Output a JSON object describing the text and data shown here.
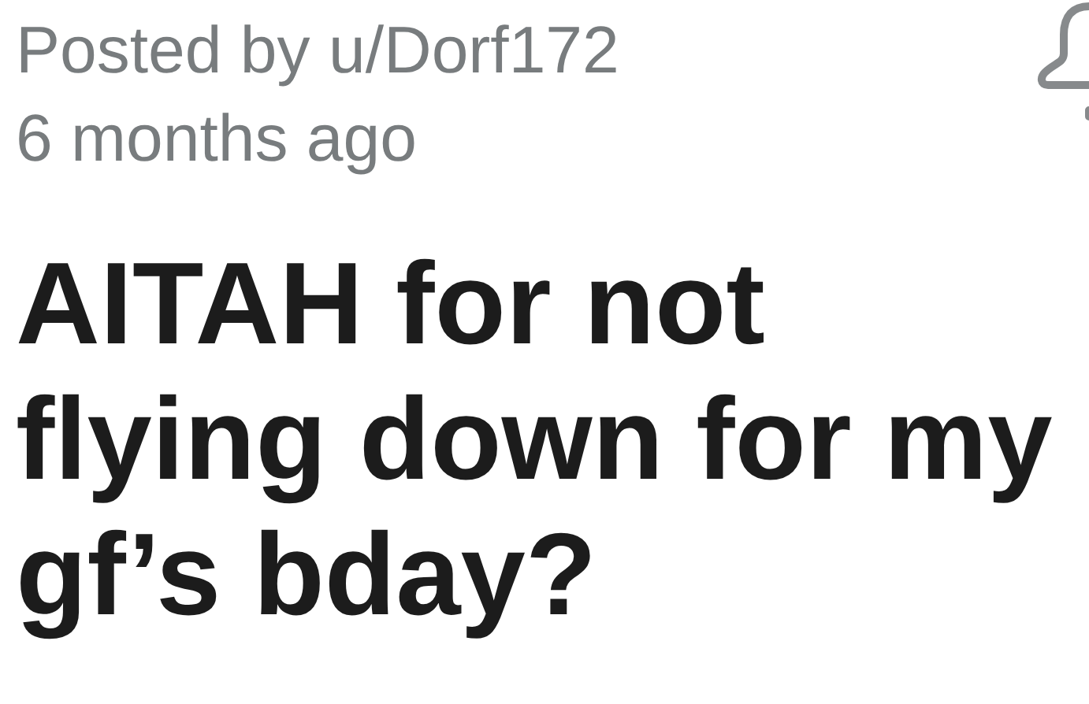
{
  "post": {
    "author_line": "Posted by u/Dorf172",
    "age": "6 months ago",
    "title": "AITAH for not flying down for my gf’s bday?"
  }
}
